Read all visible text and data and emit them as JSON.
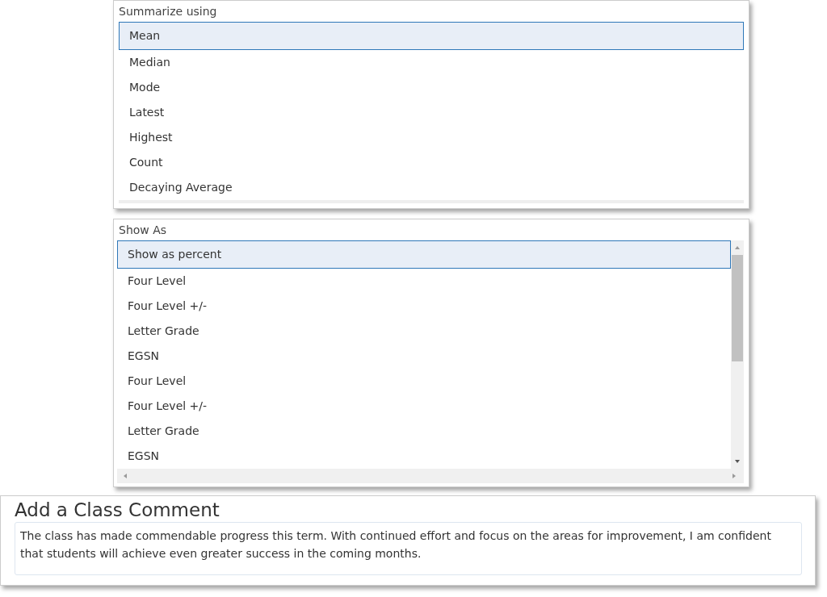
{
  "summarize": {
    "title": "Summarize using",
    "options": [
      {
        "label": "Mean",
        "selected": true
      },
      {
        "label": "Median",
        "selected": false
      },
      {
        "label": "Mode",
        "selected": false
      },
      {
        "label": "Latest",
        "selected": false
      },
      {
        "label": "Highest",
        "selected": false
      },
      {
        "label": "Count",
        "selected": false
      },
      {
        "label": "Decaying Average",
        "selected": false
      }
    ]
  },
  "show_as": {
    "title": "Show As",
    "options": [
      {
        "label": "Show as percent",
        "selected": true
      },
      {
        "label": "Four Level",
        "selected": false
      },
      {
        "label": "Four Level +/-",
        "selected": false
      },
      {
        "label": "Letter Grade",
        "selected": false
      },
      {
        "label": "EGSN",
        "selected": false
      },
      {
        "label": "Four Level",
        "selected": false
      },
      {
        "label": "Four Level +/-",
        "selected": false
      },
      {
        "label": "Letter Grade",
        "selected": false
      },
      {
        "label": "EGSN",
        "selected": false
      }
    ]
  },
  "comment": {
    "title": "Add a Class Comment",
    "value": "The class has made commendable progress this term. With continued effort and focus on the areas for improvement, I am confident that students will achieve even greater success in the coming months."
  }
}
